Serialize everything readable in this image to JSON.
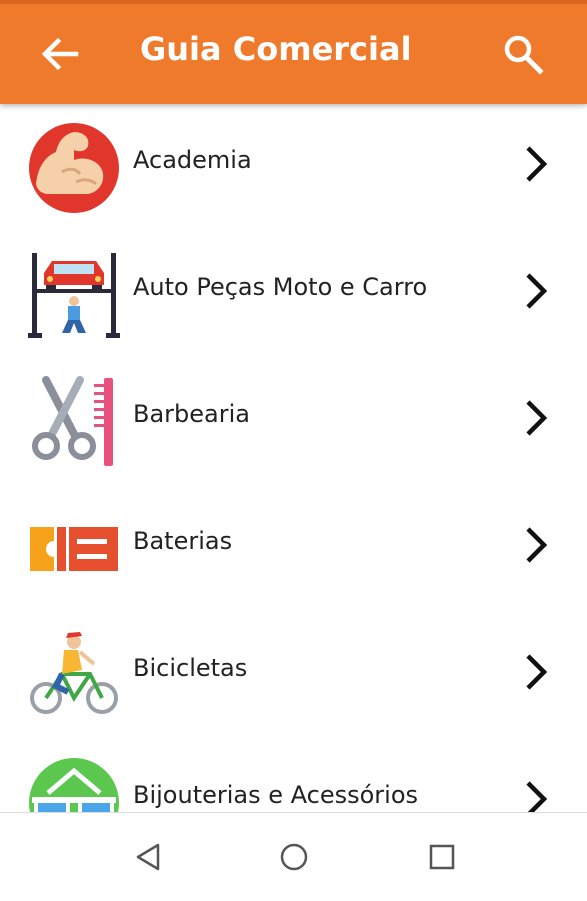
{
  "appbar": {
    "title": "Guia Comercial",
    "back_icon": "arrow-left-icon",
    "search_icon": "search-icon",
    "background_color": "#f07a2c"
  },
  "categories": [
    {
      "label": "Academia",
      "icon": "flexed-arm-icon"
    },
    {
      "label": "Auto Peças Moto e Carro",
      "icon": "car-lift-mechanic-icon"
    },
    {
      "label": "Barbearia",
      "icon": "scissors-comb-icon"
    },
    {
      "label": "Baterias",
      "icon": "battery-icon"
    },
    {
      "label": "Bicicletas",
      "icon": "cyclist-icon"
    },
    {
      "label": "Bijouterias e Acessórios",
      "icon": "sunglasses-icon"
    }
  ],
  "navbar": {
    "back_icon": "nav-back-icon",
    "home_icon": "nav-home-icon",
    "recents_icon": "nav-recents-icon"
  }
}
